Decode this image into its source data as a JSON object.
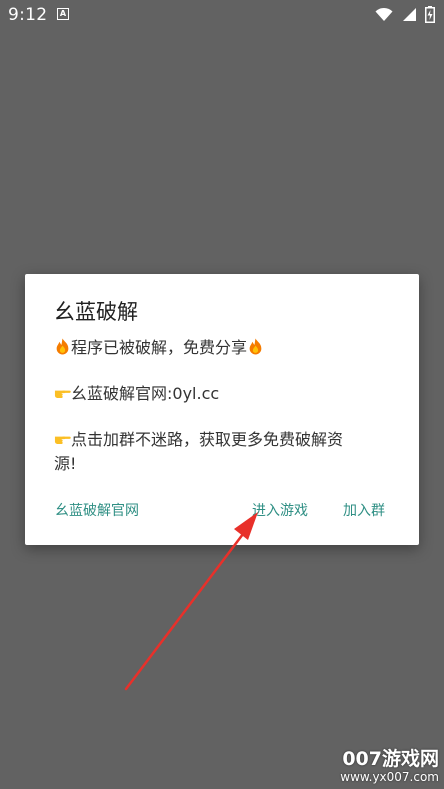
{
  "status_bar": {
    "time": "9:12",
    "notification_icon_letter": "A",
    "icons": [
      "wifi-icon",
      "signal-icon",
      "battery-charging-icon"
    ]
  },
  "dialog": {
    "title": "幺蓝破解",
    "messages": [
      {
        "text": "程序已被破解，免费分享",
        "emoji": "fire"
      },
      {
        "text": "幺蓝破解官网:0yl.cc",
        "emoji": "pointing-hand"
      },
      {
        "text_line1": "点击加群不迷路，获取更多免费破解资",
        "text_line2": "源!",
        "emoji": "pointing-hand"
      }
    ],
    "buttons": {
      "site": "幺蓝破解官网",
      "enter": "进入游戏",
      "join": "加入群"
    }
  },
  "watermark": {
    "main": "007游戏网",
    "sub": "www.yx007.com"
  },
  "colors": {
    "background": "#626262",
    "button_text": "#2f8f84",
    "arrow": "#e8302a"
  }
}
